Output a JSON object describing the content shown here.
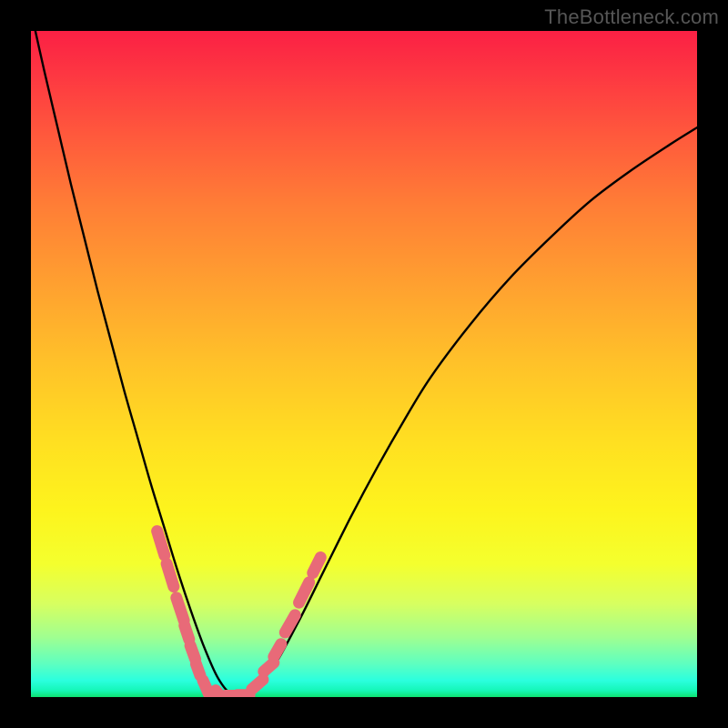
{
  "watermark": "TheBottleneck.com",
  "colors": {
    "frame": "#000000",
    "curve": "#000000",
    "marker_fill": "#e86a78",
    "marker_stroke": "#d24f5e"
  },
  "chart_data": {
    "type": "line",
    "title": "",
    "xlabel": "",
    "ylabel": "",
    "xlim": [
      0,
      100
    ],
    "ylim": [
      0,
      100
    ],
    "grid": false,
    "note": "Axes carry no tick labels; x is a normalized 0–100 parameter, y is bottleneck % (0 at bottom/green, 100 at top/red). Values estimated from pixel positions.",
    "series": [
      {
        "name": "bottleneck-curve",
        "x": [
          0,
          2,
          4,
          6,
          8,
          10,
          12,
          14,
          16,
          18,
          20,
          22,
          24,
          26,
          28,
          30,
          32,
          36,
          40,
          44,
          48,
          52,
          56,
          60,
          66,
          72,
          78,
          84,
          90,
          96,
          100
        ],
        "y": [
          103,
          94,
          85.5,
          77,
          69,
          61,
          53.5,
          46,
          39,
          32,
          25.5,
          19,
          13,
          7.5,
          3,
          0.5,
          0.5,
          4,
          11,
          19,
          27,
          34.5,
          41.5,
          48,
          56,
          63,
          69,
          74.5,
          79,
          83,
          85.5
        ]
      }
    ],
    "markers": {
      "name": "highlighted-points",
      "note": "Salmon rounded markers near the trough of the curve",
      "points": [
        {
          "x": 19.5,
          "y": 23.1,
          "len": 3.8
        },
        {
          "x": 20.9,
          "y": 18.3,
          "len": 3.6
        },
        {
          "x": 22.4,
          "y": 13.2,
          "len": 3.6
        },
        {
          "x": 23.4,
          "y": 9.7,
          "len": 2.2
        },
        {
          "x": 24.3,
          "y": 6.7,
          "len": 2.2
        },
        {
          "x": 25.1,
          "y": 4.1,
          "len": 1.8
        },
        {
          "x": 26.3,
          "y": 1.4,
          "len": 2.4
        },
        {
          "x": 28.3,
          "y": 0.3,
          "len": 1.8
        },
        {
          "x": 30.1,
          "y": 0.2,
          "len": 1.8
        },
        {
          "x": 31.9,
          "y": 0.3,
          "len": 1.8
        },
        {
          "x": 34.0,
          "y": 1.9,
          "len": 2.2
        },
        {
          "x": 35.7,
          "y": 4.5,
          "len": 2.0
        },
        {
          "x": 37.0,
          "y": 7.0,
          "len": 2.2
        },
        {
          "x": 38.9,
          "y": 11.0,
          "len": 3.0
        },
        {
          "x": 41.0,
          "y": 15.7,
          "len": 3.4
        },
        {
          "x": 42.9,
          "y": 19.8,
          "len": 2.6
        }
      ]
    }
  }
}
